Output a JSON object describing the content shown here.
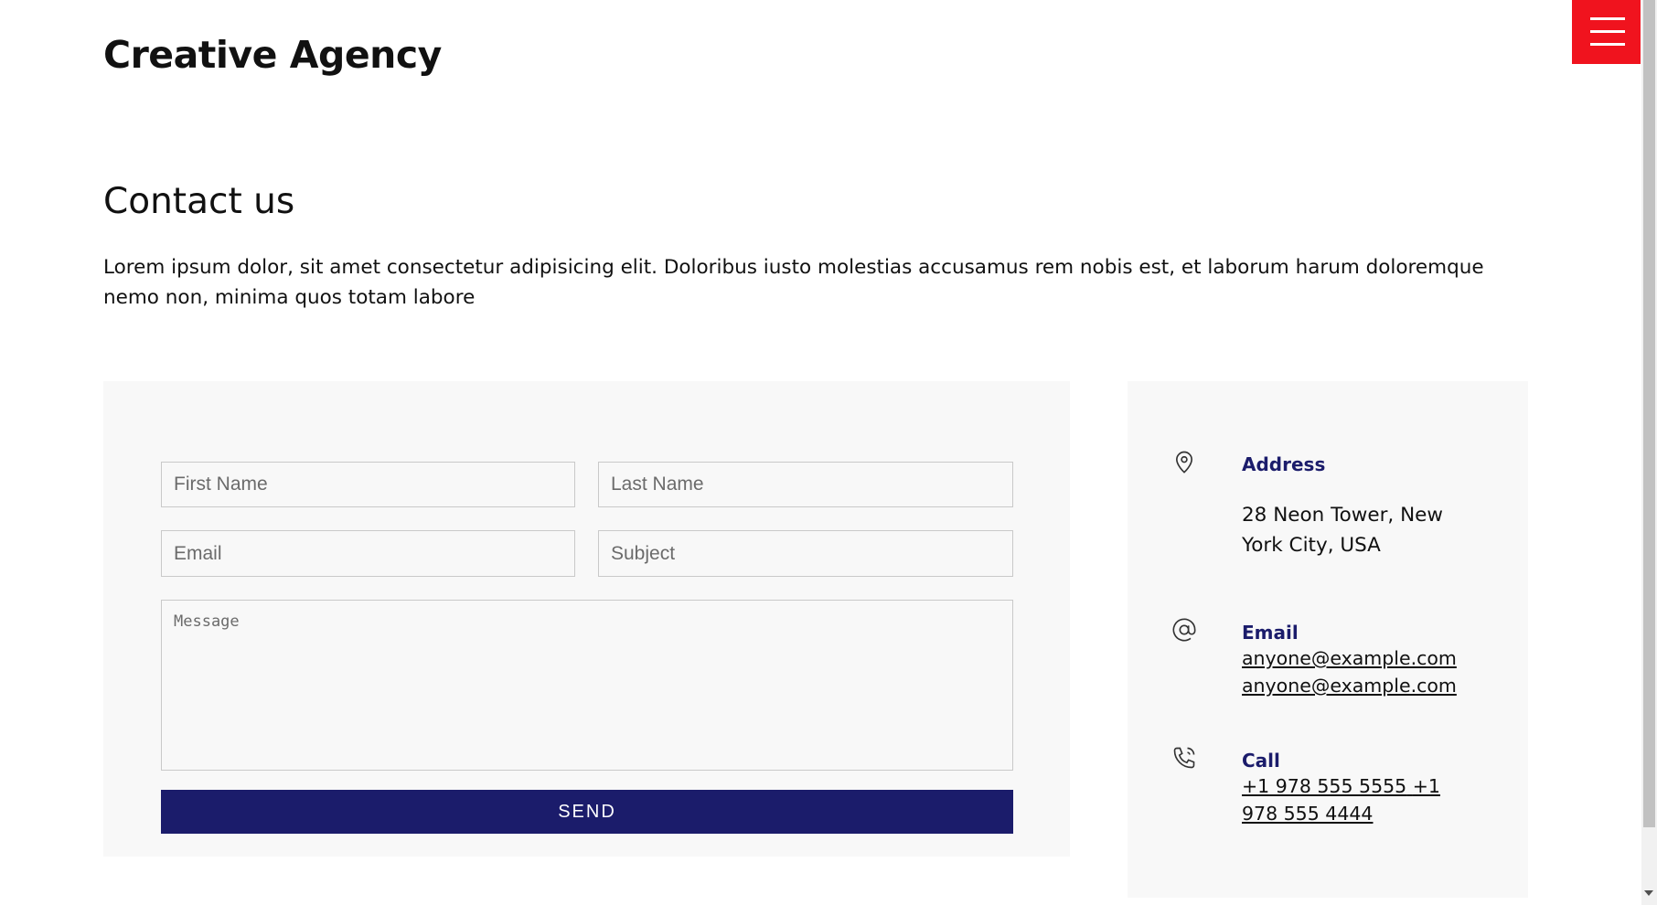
{
  "header": {
    "brand": "Creative Agency",
    "menu_icon": "hamburger-menu-icon",
    "accent_color": "#f0131e"
  },
  "contact": {
    "title": "Contact us",
    "intro": "Lorem ipsum dolor, sit amet consectetur adipisicing elit. Doloribus iusto molestias accusamus rem nobis est, et laborum harum doloremque nemo non, minima quos totam labore"
  },
  "form": {
    "first_name_placeholder": "First Name",
    "last_name_placeholder": "Last Name",
    "email_placeholder": "Email",
    "subject_placeholder": "Subject",
    "message_placeholder": "Message",
    "send_label": "SEND",
    "button_color": "#1b1c6b"
  },
  "info": {
    "address": {
      "icon": "map-pin-icon",
      "heading": "Address",
      "text": "28 Neon Tower, New York City, USA"
    },
    "email": {
      "icon": "at-sign-icon",
      "heading": "Email",
      "links": [
        "anyone@example.com",
        "anyone@example.com"
      ]
    },
    "call": {
      "icon": "phone-call-icon",
      "heading": "Call",
      "links": [
        "+1 978 555 5555",
        "+1 978 555 4444"
      ]
    }
  }
}
